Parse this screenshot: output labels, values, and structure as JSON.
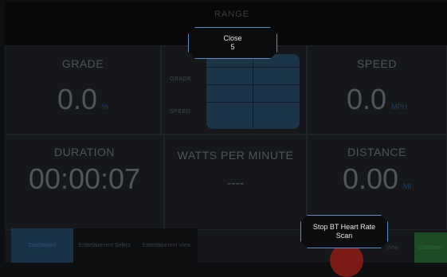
{
  "header": {
    "title": "RANGE"
  },
  "tiles": {
    "grade": {
      "label": "GRADE",
      "value": "0.0",
      "unit": "%"
    },
    "speed": {
      "label": "SPEED",
      "value": "0.0",
      "unit": "MPH"
    },
    "duration": {
      "label": "DURATION",
      "value": "00:00:07"
    },
    "watts": {
      "label": "WATTS PER MINUTE",
      "value": "----"
    },
    "distance": {
      "label": "DISTANCE",
      "value": "0.00",
      "unit": "MI"
    }
  },
  "center_panel": {
    "grade_label": "GRADE",
    "speed_label": "SPEED"
  },
  "tabs": [
    {
      "label": "Dashboard"
    },
    {
      "label": "Entertainment Select"
    },
    {
      "label": "Entertainment View"
    }
  ],
  "view_button": {
    "label": "View"
  },
  "green_button": {
    "label": "Cooldown"
  },
  "popups": {
    "close": {
      "title": "Close",
      "count": "5"
    },
    "bt": {
      "line1": "Stop BT Heart Rate",
      "line2": "Scan"
    }
  },
  "colors": {
    "accent": "#5a8fc8",
    "background": "#15171a",
    "active_tab": "#1a3247"
  }
}
